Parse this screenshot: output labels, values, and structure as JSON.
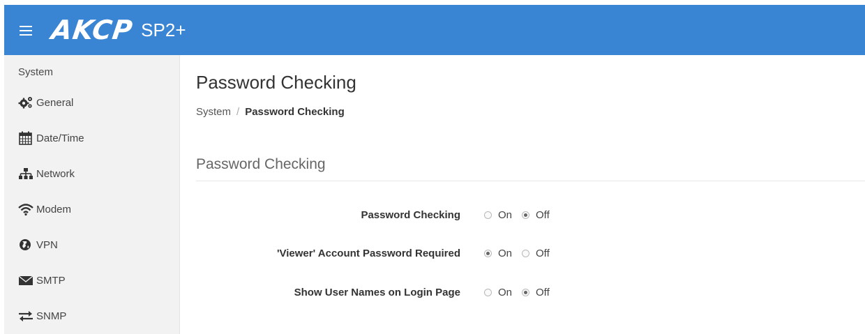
{
  "header": {
    "logo_text": "AKCP",
    "product": "SP2+",
    "menu_icon": "hamburger-menu-icon"
  },
  "sidebar": {
    "heading": "System",
    "items": [
      {
        "label": "General",
        "icon": "gears-icon"
      },
      {
        "label": "Date/Time",
        "icon": "calendar-icon"
      },
      {
        "label": "Network",
        "icon": "sitemap-icon"
      },
      {
        "label": "Modem",
        "icon": "wifi-icon"
      },
      {
        "label": "VPN",
        "icon": "globe-icon"
      },
      {
        "label": "SMTP",
        "icon": "envelope-icon"
      },
      {
        "label": "SNMP",
        "icon": "exchange-arrows-icon"
      }
    ]
  },
  "page": {
    "title": "Password Checking",
    "breadcrumb": {
      "parent": "System",
      "separator": "/",
      "current": "Password Checking"
    },
    "section_title": "Password Checking"
  },
  "form": {
    "rows": [
      {
        "label": "Password Checking",
        "on_label": "On",
        "off_label": "Off",
        "selected": "Off"
      },
      {
        "label": "'Viewer' Account Password Required",
        "on_label": "On",
        "off_label": "Off",
        "selected": "On"
      },
      {
        "label": "Show User Names on Login Page",
        "on_label": "On",
        "off_label": "Off",
        "selected": "Off"
      }
    ]
  },
  "colors": {
    "header_bg": "#3a85d3",
    "sidebar_bg": "#f2f2f2"
  }
}
